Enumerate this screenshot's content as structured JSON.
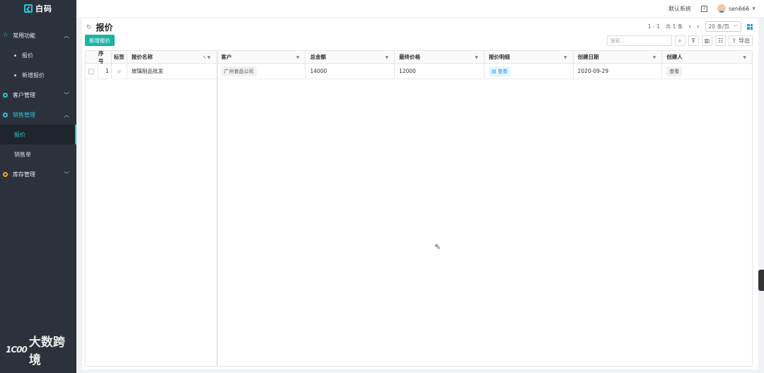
{
  "app": {
    "logo_text": "白码"
  },
  "sidebar": {
    "groups": [
      {
        "label": "常用功能",
        "subs": [
          "报价",
          "新增报价"
        ]
      },
      {
        "label": "客户管理"
      },
      {
        "label": "销售管理",
        "subs": [
          "报价",
          "销售单"
        ]
      },
      {
        "label": "库存管理"
      }
    ]
  },
  "watermark": {
    "logo": "1C00",
    "text": "大数跨境"
  },
  "topbar": {
    "system": "默认系统",
    "help": "?",
    "username": "sen666"
  },
  "page": {
    "title": "报价"
  },
  "pager": {
    "range": "1 - 1",
    "total": "共 1 条",
    "page_size": "20 条/页"
  },
  "toolbar": {
    "add_label": "新增报价",
    "search_placeholder": "搜索...",
    "export_label": "导出"
  },
  "table": {
    "headers": {
      "no": "序号",
      "tag": "标签",
      "name": "报价名称",
      "customer": "客户",
      "total": "总金额",
      "final": "最终价格",
      "detail": "报价明细",
      "date": "创建日期",
      "creator": "创建人"
    },
    "rows": [
      {
        "no": "1",
        "name": "玻璃制品批发",
        "customer": "广州食品公司",
        "total": "14000",
        "final": "12000",
        "detail": "查看",
        "date": "2020-09-29",
        "creator": "查看"
      }
    ]
  },
  "colors": {
    "accent": "#1ab3a6",
    "sidebar_bg": "#2b323b",
    "link": "#1890ff"
  }
}
